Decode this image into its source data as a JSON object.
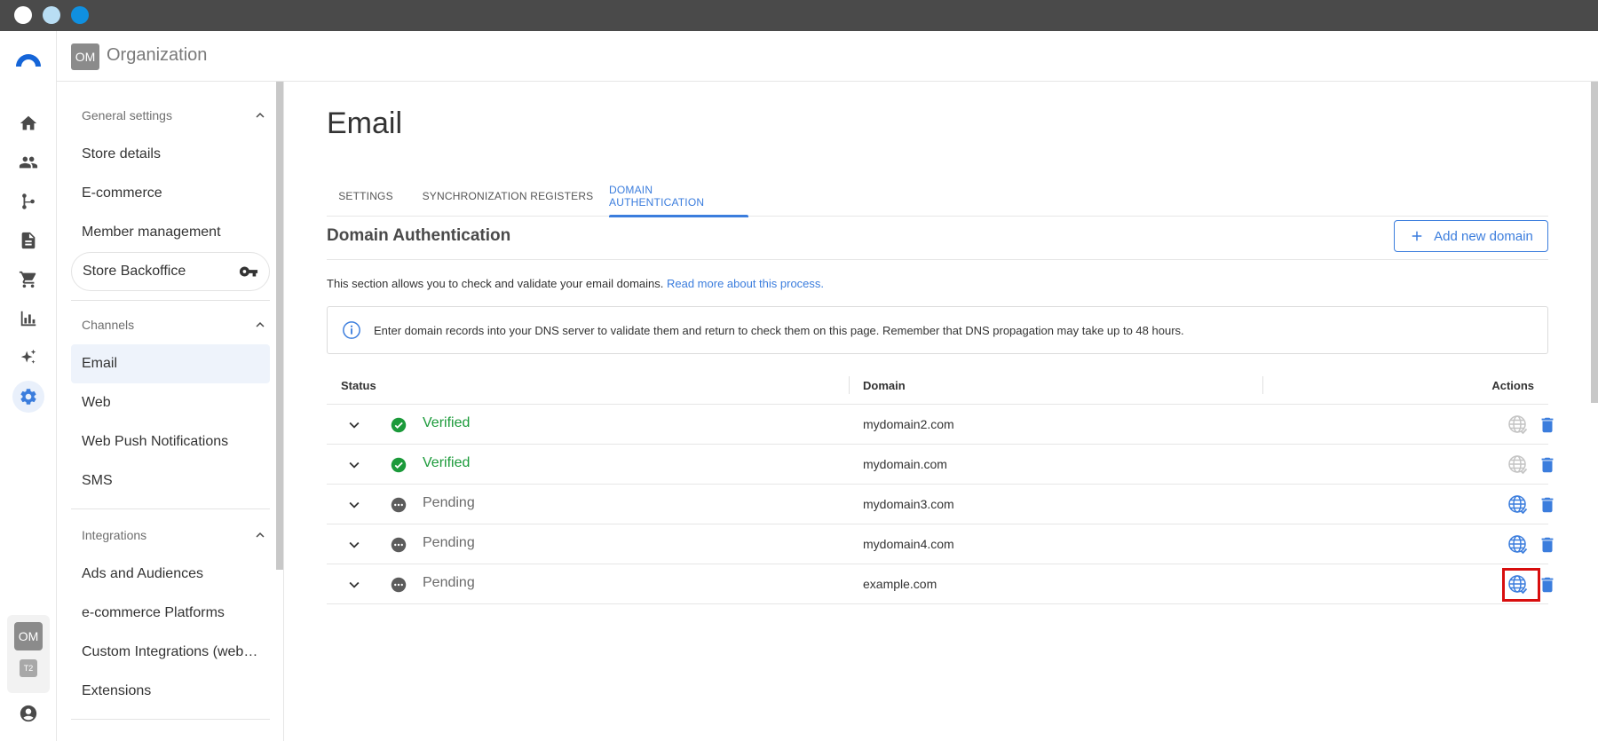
{
  "window": {
    "dot_colors": [
      "#ffffff",
      "#b9def4",
      "#1090e0"
    ]
  },
  "rail": {
    "icons": [
      "home-icon",
      "people-icon",
      "flow-icon",
      "document-icon",
      "cart-icon",
      "bar-chart-icon",
      "sparkle-icon",
      "gear-icon"
    ],
    "active": "gear-icon",
    "workspace_avatar": "OM",
    "workspace_sub": "T2"
  },
  "header": {
    "org_avatar": "OM",
    "org_name": "Organization"
  },
  "sidebar": {
    "general": {
      "title": "General settings",
      "items": [
        "Store details",
        "E-commerce",
        "Member management",
        "Store Backoffice"
      ]
    },
    "channels": {
      "title": "Channels",
      "items": [
        "Email",
        "Web",
        "Web Push Notifications",
        "SMS"
      ],
      "active": "Email"
    },
    "integrations": {
      "title": "Integrations",
      "items": [
        "Ads and Audiences",
        "e-commerce Platforms",
        "Custom Integrations (webh…",
        "Extensions"
      ]
    }
  },
  "main": {
    "title": "Email",
    "tabs": [
      "SETTINGS",
      "SYNCHRONIZATION REGISTERS",
      "DOMAIN AUTHENTICATION"
    ],
    "active_tab": "DOMAIN AUTHENTICATION",
    "section_title": "Domain Authentication",
    "add_button": "Add new domain",
    "description": "This section allows you to check and validate your email domains.",
    "description_link": "Read more about this process.",
    "info": "Enter domain records into your DNS server to validate them and return to check them on this page. Remember that DNS propagation may take up to 48 hours.",
    "table": {
      "headers": {
        "status": "Status",
        "domain": "Domain",
        "actions": "Actions"
      },
      "rows": [
        {
          "status": "Verified",
          "domain": "mydomain2.com"
        },
        {
          "status": "Verified",
          "domain": "mydomain.com"
        },
        {
          "status": "Pending",
          "domain": "mydomain3.com"
        },
        {
          "status": "Pending",
          "domain": "mydomain4.com"
        },
        {
          "status": "Pending",
          "domain": "example.com"
        }
      ]
    }
  },
  "colors": {
    "accent": "#3b7ddd",
    "verified": "#1b9a3a",
    "pending": "#6a6a6a",
    "highlight": "#d80e0e"
  }
}
